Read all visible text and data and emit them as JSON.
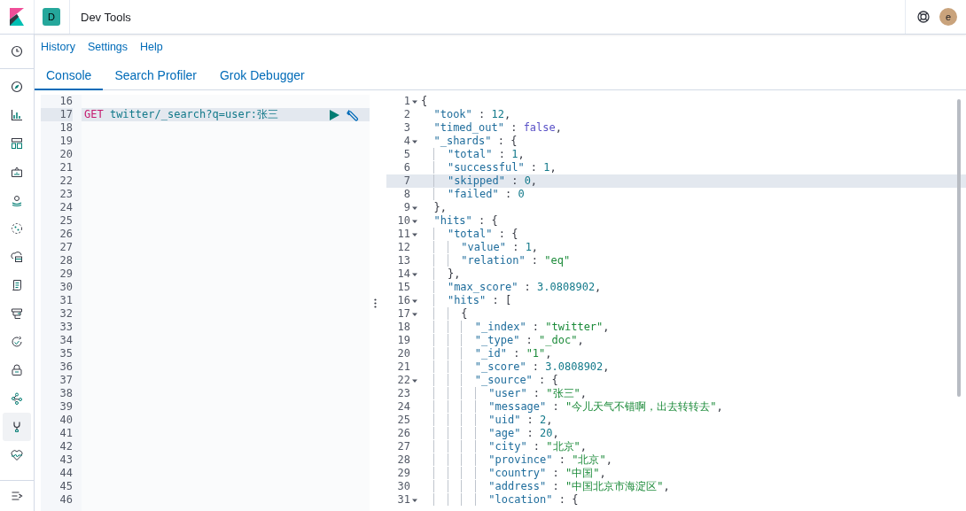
{
  "header": {
    "space_badge": "D",
    "title": "Dev Tools",
    "avatar": "e"
  },
  "sidebar": {
    "items": [
      {
        "kind": "clock",
        "selected": false
      },
      {
        "kind": "compass",
        "selected": false
      },
      {
        "kind": "chart",
        "selected": false
      },
      {
        "kind": "dashboard",
        "selected": false
      },
      {
        "kind": "canvas",
        "selected": false
      },
      {
        "kind": "map",
        "selected": false
      },
      {
        "kind": "ml",
        "selected": false
      },
      {
        "kind": "cloud",
        "selected": false
      },
      {
        "kind": "logs",
        "selected": false
      },
      {
        "kind": "apm",
        "selected": false
      },
      {
        "kind": "uptime",
        "selected": false
      },
      {
        "kind": "lock",
        "selected": false
      },
      {
        "kind": "graph",
        "selected": false
      },
      {
        "kind": "wrench",
        "selected": true
      },
      {
        "kind": "heart",
        "selected": false
      },
      {
        "kind": "collapse",
        "selected": false
      }
    ]
  },
  "menu": [
    "History",
    "Settings",
    "Help"
  ],
  "tabs": [
    {
      "label": "Console",
      "selected": true
    },
    {
      "label": "Search Profiler",
      "selected": false
    },
    {
      "label": "Grok Debugger",
      "selected": false
    }
  ],
  "request": {
    "lines": [
      {
        "number": "16",
        "selected": false
      },
      {
        "number": "17",
        "text": "GET twitter/_search?q=user:张三",
        "selected": true
      },
      {
        "number": "18",
        "selected": false
      },
      {
        "number": "19",
        "selected": false
      },
      {
        "number": "20",
        "selected": false
      },
      {
        "number": "21",
        "selected": false
      },
      {
        "number": "22",
        "selected": false
      },
      {
        "number": "23",
        "selected": false
      },
      {
        "number": "24",
        "selected": false
      },
      {
        "number": "25",
        "selected": false
      },
      {
        "number": "26",
        "selected": false
      },
      {
        "number": "27",
        "selected": false
      },
      {
        "number": "28",
        "selected": false
      },
      {
        "number": "29",
        "selected": false
      },
      {
        "number": "30",
        "selected": false
      },
      {
        "number": "31",
        "selected": false
      },
      {
        "number": "32",
        "selected": false
      },
      {
        "number": "33",
        "selected": false
      },
      {
        "number": "34",
        "selected": false
      },
      {
        "number": "35",
        "selected": false
      },
      {
        "number": "36",
        "selected": false
      },
      {
        "number": "37",
        "selected": false
      },
      {
        "number": "38",
        "selected": false
      },
      {
        "number": "39",
        "selected": false
      },
      {
        "number": "40",
        "selected": false
      },
      {
        "number": "41",
        "selected": false
      },
      {
        "number": "42",
        "selected": false
      },
      {
        "number": "43",
        "selected": false
      },
      {
        "number": "44",
        "selected": false
      },
      {
        "number": "45",
        "selected": false
      },
      {
        "number": "46",
        "selected": false
      }
    ]
  },
  "response": {
    "lines": [
      {
        "number": "1",
        "text": "{",
        "fold": true,
        "selected": false
      },
      {
        "number": "2",
        "text": "  \"took\" : 12,",
        "fold": false,
        "selected": false
      },
      {
        "number": "3",
        "text": "  \"timed_out\" : false,",
        "fold": false,
        "selected": false
      },
      {
        "number": "4",
        "text": "  \"_shards\" : {",
        "fold": true,
        "selected": false
      },
      {
        "number": "5",
        "text": "    \"total\" : 1,",
        "fold": false,
        "selected": false
      },
      {
        "number": "6",
        "text": "    \"successful\" : 1,",
        "fold": false,
        "selected": false
      },
      {
        "number": "7",
        "text": "    \"skipped\" : 0,",
        "fold": false,
        "selected": true
      },
      {
        "number": "8",
        "text": "    \"failed\" : 0",
        "fold": false,
        "selected": false
      },
      {
        "number": "9",
        "text": "  },",
        "fold": true,
        "selected": false
      },
      {
        "number": "10",
        "text": "  \"hits\" : {",
        "fold": true,
        "selected": false
      },
      {
        "number": "11",
        "text": "    \"total\" : {",
        "fold": true,
        "selected": false
      },
      {
        "number": "12",
        "text": "      \"value\" : 1,",
        "fold": false,
        "selected": false
      },
      {
        "number": "13",
        "text": "      \"relation\" : \"eq\"",
        "fold": false,
        "selected": false
      },
      {
        "number": "14",
        "text": "    },",
        "fold": true,
        "selected": false
      },
      {
        "number": "15",
        "text": "    \"max_score\" : 3.0808902,",
        "fold": false,
        "selected": false
      },
      {
        "number": "16",
        "text": "    \"hits\" : [",
        "fold": true,
        "selected": false
      },
      {
        "number": "17",
        "text": "      {",
        "fold": true,
        "selected": false
      },
      {
        "number": "18",
        "text": "        \"_index\" : \"twitter\",",
        "fold": false,
        "selected": false
      },
      {
        "number": "19",
        "text": "        \"_type\" : \"_doc\",",
        "fold": false,
        "selected": false
      },
      {
        "number": "20",
        "text": "        \"_id\" : \"1\",",
        "fold": false,
        "selected": false
      },
      {
        "number": "21",
        "text": "        \"_score\" : 3.0808902,",
        "fold": false,
        "selected": false
      },
      {
        "number": "22",
        "text": "        \"_source\" : {",
        "fold": true,
        "selected": false
      },
      {
        "number": "23",
        "text": "          \"user\" : \"张三\",",
        "fold": false,
        "selected": false
      },
      {
        "number": "24",
        "text": "          \"message\" : \"今儿天气不错啊，出去转转去\",",
        "fold": false,
        "selected": false
      },
      {
        "number": "25",
        "text": "          \"uid\" : 2,",
        "fold": false,
        "selected": false
      },
      {
        "number": "26",
        "text": "          \"age\" : 20,",
        "fold": false,
        "selected": false
      },
      {
        "number": "27",
        "text": "          \"city\" : \"北京\",",
        "fold": false,
        "selected": false
      },
      {
        "number": "28",
        "text": "          \"province\" : \"北京\",",
        "fold": false,
        "selected": false
      },
      {
        "number": "29",
        "text": "          \"country\" : \"中国\",",
        "fold": false,
        "selected": false
      },
      {
        "number": "30",
        "text": "          \"address\" : \"中国北京市海淀区\",",
        "fold": false,
        "selected": false
      },
      {
        "number": "31",
        "text": "          \"location\" : {",
        "fold": true,
        "selected": false
      }
    ]
  }
}
